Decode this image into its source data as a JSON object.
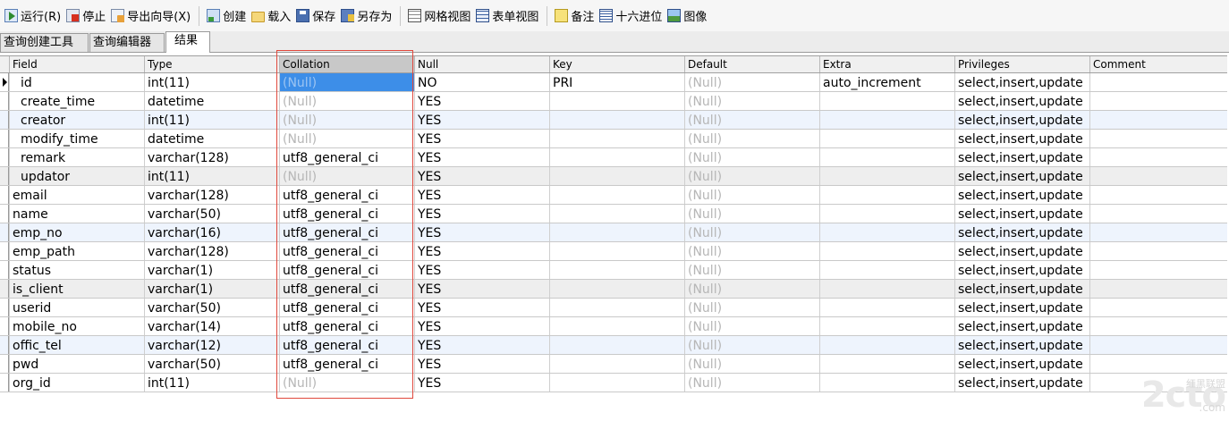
{
  "toolbar": {
    "run": "运行(R)",
    "stop": "停止",
    "export_wizard": "导出向导(X)",
    "create": "创建",
    "load": "载入",
    "save": "保存",
    "save_as": "另存为",
    "grid_view": "网格视图",
    "form_view": "表单视图",
    "note": "备注",
    "hex": "十六进位",
    "image": "图像"
  },
  "tabs": [
    "查询创建工具",
    "查询编辑器",
    "结果"
  ],
  "active_tab": 2,
  "columns": [
    "Field",
    "Type",
    "Collation",
    "Null",
    "Key",
    "Default",
    "Extra",
    "Privileges",
    "Comment"
  ],
  "selected_column": "Collation",
  "rows": [
    [
      "id",
      "int(11)",
      "(Null)",
      "NO",
      "PRI",
      "(Null)",
      "auto_increment",
      "select,insert,update",
      ""
    ],
    [
      "create_time",
      "datetime",
      "(Null)",
      "YES",
      "",
      "(Null)",
      "",
      "select,insert,update",
      ""
    ],
    [
      "creator",
      "int(11)",
      "(Null)",
      "YES",
      "",
      "(Null)",
      "",
      "select,insert,update",
      ""
    ],
    [
      "modify_time",
      "datetime",
      "(Null)",
      "YES",
      "",
      "(Null)",
      "",
      "select,insert,update",
      ""
    ],
    [
      "remark",
      "varchar(128)",
      "utf8_general_ci",
      "YES",
      "",
      "(Null)",
      "",
      "select,insert,update",
      ""
    ],
    [
      "updator",
      "int(11)",
      "(Null)",
      "YES",
      "",
      "(Null)",
      "",
      "select,insert,update",
      ""
    ],
    [
      "email",
      "varchar(128)",
      "utf8_general_ci",
      "YES",
      "",
      "(Null)",
      "",
      "select,insert,update",
      ""
    ],
    [
      "name",
      "varchar(50)",
      "utf8_general_ci",
      "YES",
      "",
      "(Null)",
      "",
      "select,insert,update",
      ""
    ],
    [
      "emp_no",
      "varchar(16)",
      "utf8_general_ci",
      "YES",
      "",
      "(Null)",
      "",
      "select,insert,update",
      ""
    ],
    [
      "emp_path",
      "varchar(128)",
      "utf8_general_ci",
      "YES",
      "",
      "(Null)",
      "",
      "select,insert,update",
      ""
    ],
    [
      "status",
      "varchar(1)",
      "utf8_general_ci",
      "YES",
      "",
      "(Null)",
      "",
      "select,insert,update",
      ""
    ],
    [
      "is_client",
      "varchar(1)",
      "utf8_general_ci",
      "YES",
      "",
      "(Null)",
      "",
      "select,insert,update",
      ""
    ],
    [
      "userid",
      "varchar(50)",
      "utf8_general_ci",
      "YES",
      "",
      "(Null)",
      "",
      "select,insert,update",
      ""
    ],
    [
      "mobile_no",
      "varchar(14)",
      "utf8_general_ci",
      "YES",
      "",
      "(Null)",
      "",
      "select,insert,update",
      ""
    ],
    [
      "offic_tel",
      "varchar(12)",
      "utf8_general_ci",
      "YES",
      "",
      "(Null)",
      "",
      "select,insert,update",
      ""
    ],
    [
      "pwd",
      "varchar(50)",
      "utf8_general_ci",
      "YES",
      "",
      "(Null)",
      "",
      "select,insert,update",
      ""
    ],
    [
      "org_id",
      "int(11)",
      "(Null)",
      "YES",
      "",
      "(Null)",
      "",
      "select,insert,update",
      ""
    ]
  ],
  "row_tints": [
    "#ffffff",
    "#ffffff",
    "#eef4fd",
    "#ffffff",
    "#ffffff",
    "#eeeeee",
    "#ffffff",
    "#ffffff",
    "#eef4fd",
    "#ffffff",
    "#ffffff",
    "#eeeeee",
    "#ffffff",
    "#ffffff",
    "#eef4fd",
    "#ffffff",
    "#ffffff"
  ],
  "watermark": {
    "logo": "2cto",
    "site": "红黑联盟",
    "domain": ".com"
  },
  "colors": {
    "selection": "#3d8ee8",
    "highlight_box": "#e0483c"
  }
}
